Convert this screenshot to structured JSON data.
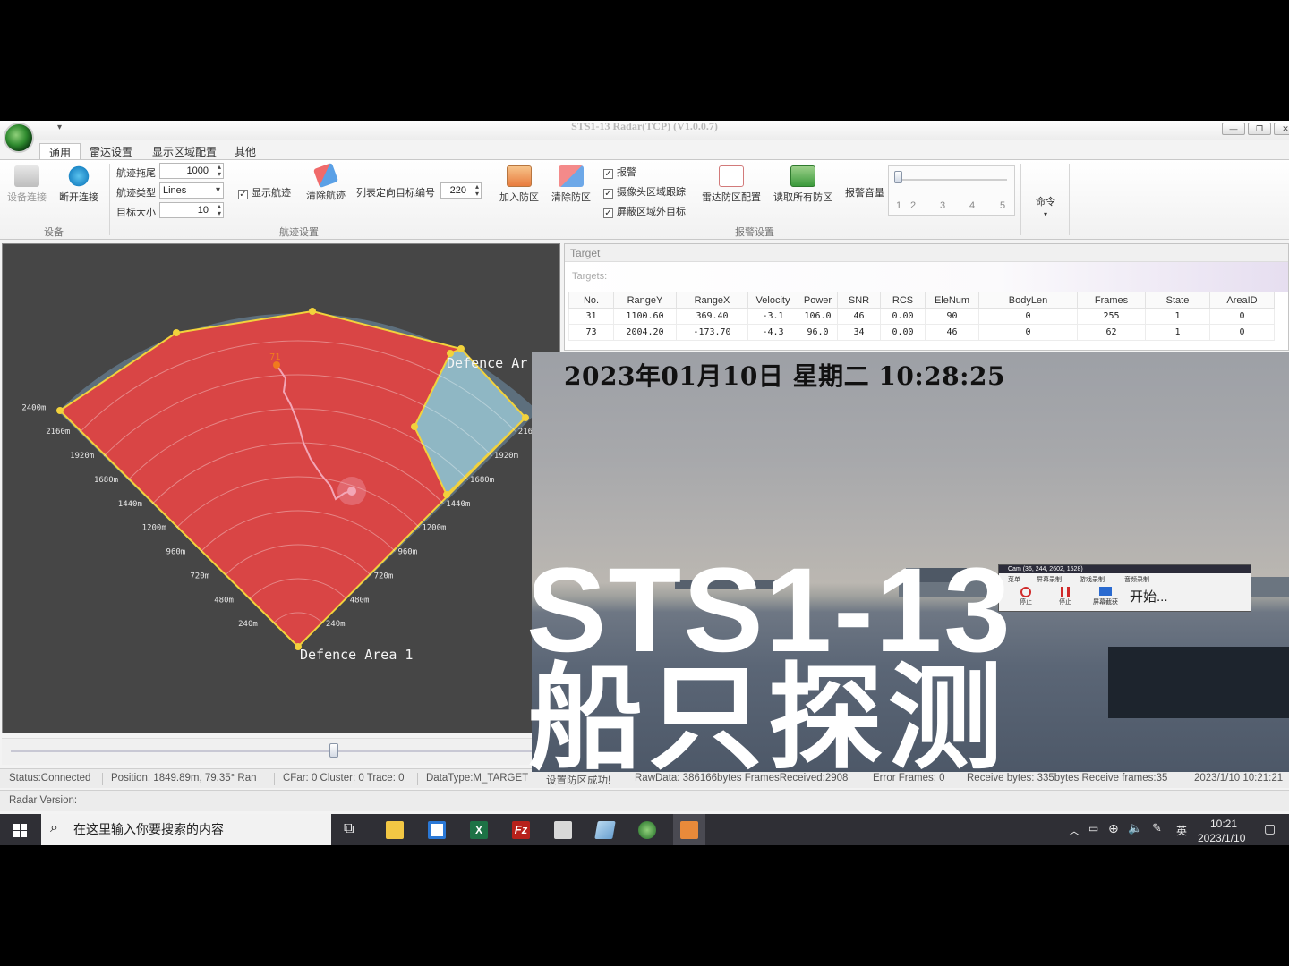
{
  "window": {
    "title": "STS1-13 Radar(TCP) (V1.0.0.7)",
    "quick_access": "▾",
    "minimize": "—",
    "restore": "❐",
    "close": "✕"
  },
  "tabs": [
    "通用",
    "雷达设置",
    "显示区域配置",
    "其他"
  ],
  "ribbon": {
    "device": {
      "connect": "设备连接",
      "disconnect": "断开连接",
      "group": "设备"
    },
    "track": {
      "tail_label": "航迹拖尾",
      "tail_value": "1000",
      "type_label": "航迹类型",
      "type_value": "Lines",
      "size_label": "目标大小",
      "size_value": "10",
      "show_track": "显示航迹",
      "clear_track": "清除航迹",
      "list_label": "列表定向目标编号",
      "list_value": "220",
      "group": "航迹设置"
    },
    "alarm": {
      "add_zone": "加入防区",
      "clear_zone": "清除防区",
      "alarm": "报警",
      "camera_track": "摄像头区域跟踪",
      "mask_outside": "屏蔽区域外目标",
      "radar_zone_config": "雷达防区配置",
      "read_all_zones": "读取所有防区",
      "volume_label": "报警音量",
      "volume_ticks": [
        "1",
        "2",
        "3",
        "4",
        "5"
      ],
      "group": "报警设置"
    },
    "command": {
      "label": "命令"
    }
  },
  "radar": {
    "area1_label": "Defence Area 1",
    "area2_label": "Defence Ar",
    "target_id": "71",
    "left_ticks": [
      "240m",
      "480m",
      "720m",
      "960m",
      "1200m",
      "1440m",
      "1680m",
      "1920m",
      "2160m",
      "2400m"
    ],
    "right_ticks": [
      "240m",
      "480m",
      "720m",
      "960m",
      "1200m",
      "1440m",
      "1680m",
      "1920m",
      "216"
    ]
  },
  "target_panel": {
    "title": "Target",
    "targets_label": "Targets:",
    "columns": [
      "No.",
      "RangeY",
      "RangeX",
      "Velocity",
      "Power",
      "SNR",
      "RCS",
      "EleNum",
      "BodyLen",
      "Frames",
      "State",
      "AreaID"
    ],
    "rows": [
      [
        "31",
        "1100.60",
        "369.40",
        "-3.1",
        "106.0",
        "46",
        "0.00",
        "90",
        "0",
        "255",
        "1",
        "0"
      ],
      [
        "73",
        "2004.20",
        "-173.70",
        "-4.3",
        "96.0",
        "34",
        "0.00",
        "46",
        "0",
        "62",
        "1",
        "0"
      ]
    ]
  },
  "camera": {
    "datetime": "2023年01月10日  星期二  10:28:25",
    "popup_title": "Cam (36, 244, 2602, 1528)",
    "popup_menu": [
      "菜单",
      "屏幕录制",
      "游戏录制",
      "音频录制"
    ],
    "popup_buttons": [
      "停止",
      "停止",
      "屏幕截获"
    ],
    "popup_start": "开始..."
  },
  "overlay": {
    "title": "STS1-13",
    "subtitle": "船只探测"
  },
  "status": {
    "connection": "Status:Connected",
    "position": "Position: 1849.89m,  79.35° Ran",
    "cfar": "CFar: 0 Cluster: 0 Trace: 0",
    "datatype": "DataType:M_TARGET",
    "zone_msg": "设置防区成功!",
    "rawdata": "RawData: 386166bytes FramesReceived:2908",
    "errors": "Error Frames: 0",
    "receive": "Receive bytes: 335bytes Receive frames:35",
    "timestamp": "2023/1/10 10:21:21",
    "radar_version": "Radar Version:"
  },
  "taskbar": {
    "search_placeholder": "在这里输入你要搜索的内容",
    "ime": "英",
    "time": "10:21",
    "date": "2023/1/10"
  },
  "colors": {
    "zone_red": "#d94545",
    "zone_blue": "#8fb7c4",
    "zone_edge": "#f2d23c",
    "track": "#f3a6b6"
  }
}
